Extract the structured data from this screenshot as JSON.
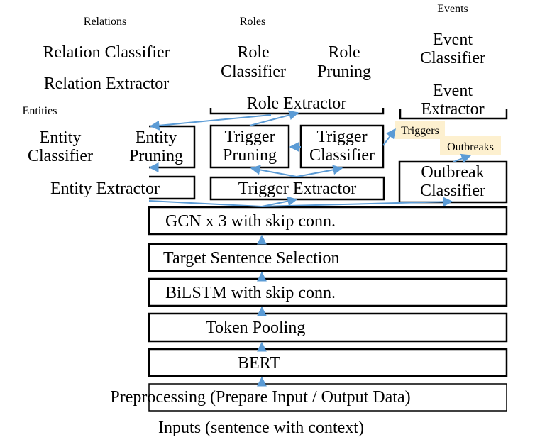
{
  "labels": {
    "relations": "Relations",
    "roles": "Roles",
    "events": "Events",
    "entities": "Entities",
    "triggers": "Triggers",
    "outbreaks": "Outbreaks"
  },
  "modules": {
    "relation_classifier": "Relation Classifier",
    "relation_extractor": "Relation Extractor",
    "role_classifier": [
      "Role",
      "Classifier"
    ],
    "role_pruning": [
      "Role",
      "Pruning"
    ],
    "event_classifier": [
      "Event",
      "Classifier"
    ],
    "event_extractor": [
      "Event",
      "Extractor"
    ],
    "role_extractor": "Role Extractor",
    "entity_classifier": [
      "Entity",
      "Classifier"
    ],
    "entity_pruning": [
      "Entity",
      "Pruning"
    ],
    "trigger_pruning": [
      "Trigger",
      "Pruning"
    ],
    "trigger_classifier": [
      "Trigger",
      "Classifier"
    ],
    "entity_extractor": "Entity Extractor",
    "trigger_extractor": "Trigger Extractor",
    "outbreak_classifier": [
      "Outbreak",
      "Classifier"
    ]
  },
  "layers": {
    "gcn": "GCN x 3 with skip conn.",
    "target_sentence": "Target Sentence Selection",
    "bilstm": "BiLSTM with skip conn.",
    "token_pooling": "Token Pooling",
    "bert": "BERT",
    "preprocessing": "Preprocessing  (Prepare Input / Output Data)",
    "inputs": "Inputs (sentence with context)"
  },
  "colors": {
    "arrow": "#5b9bd5",
    "highlight": "#fdf0cf"
  }
}
